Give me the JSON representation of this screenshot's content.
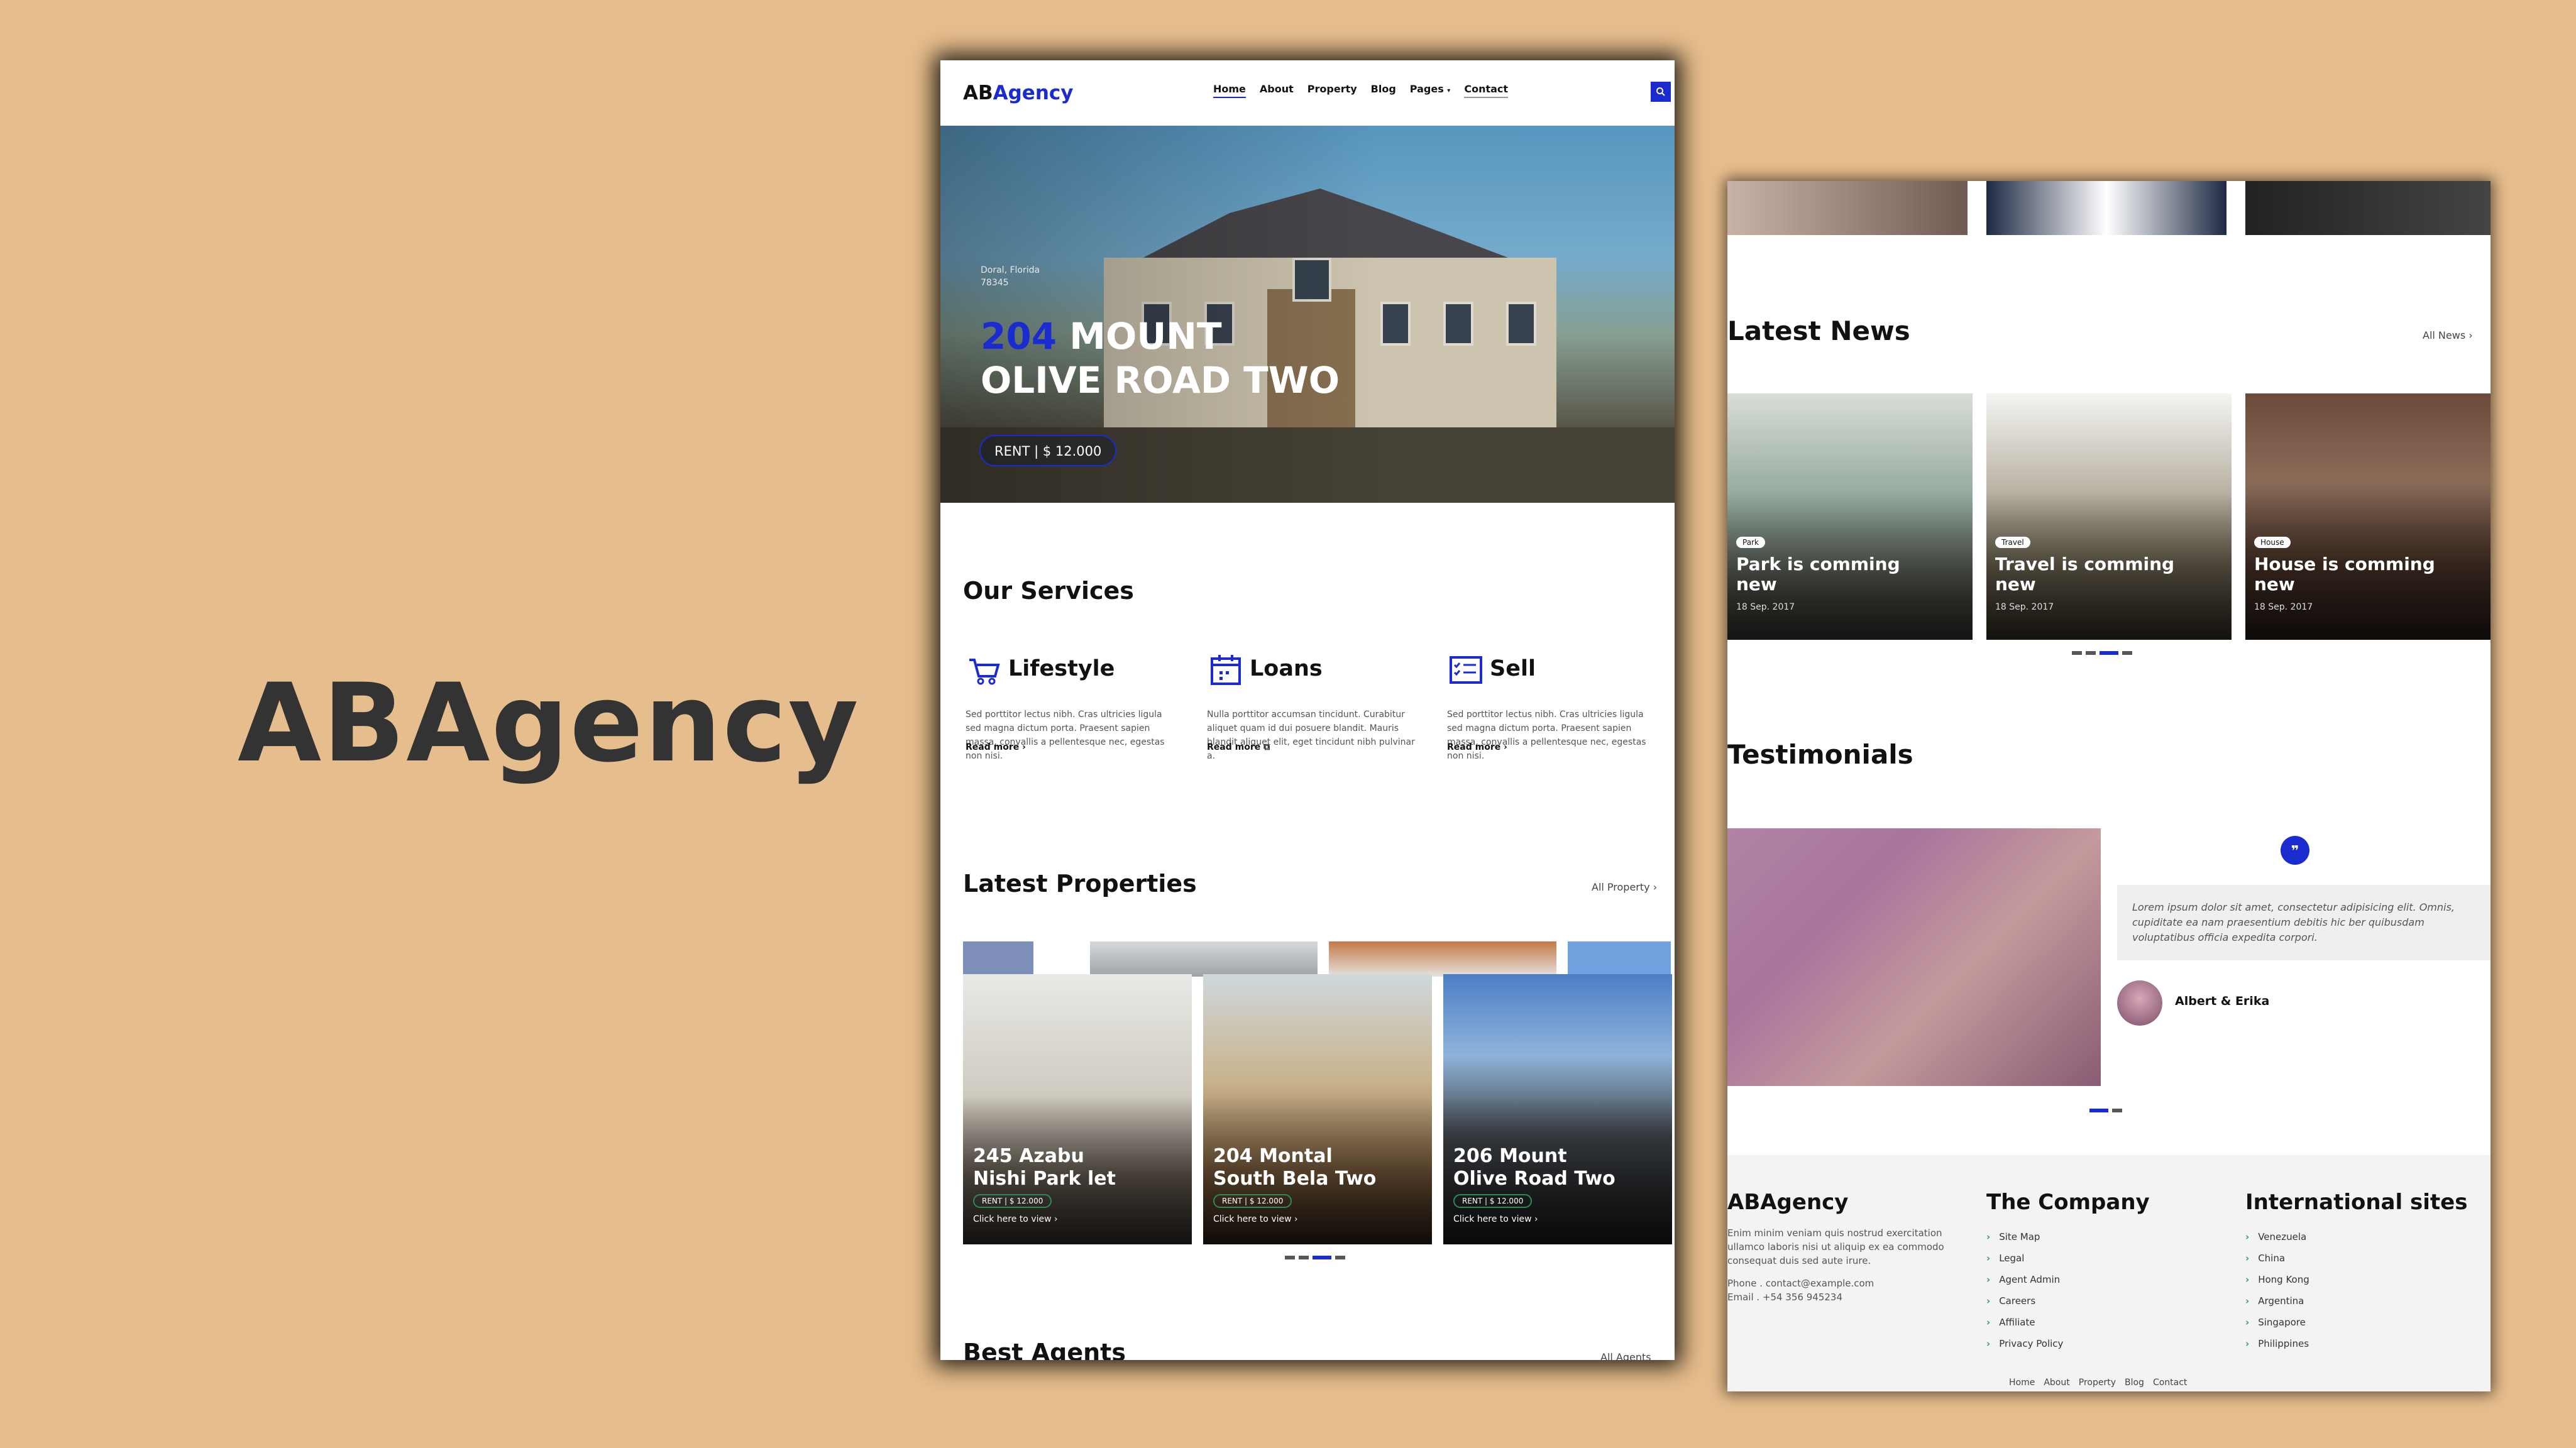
{
  "brand": "ABAgency",
  "site": {
    "logo": {
      "ab": "AB",
      "agency": "Agency"
    },
    "nav": [
      "Home",
      "About",
      "Property",
      "Blog",
      "Pages",
      "Contact"
    ],
    "hero": {
      "city": "Doral, Florida",
      "zip": "78345",
      "title_number": "204",
      "title_rest_line1": "MOUNT",
      "title_line2": "OLIVE ROAD TWO",
      "price": "RENT | $ 12.000"
    },
    "services_heading": "Our Services",
    "services": [
      {
        "icon": "cart-icon",
        "title": "Lifestyle",
        "text": "Sed porttitor lectus nibh. Cras ultricies ligula sed magna dictum porta. Praesent sapien massa, convallis a pellentesque nec, egestas non nisi.",
        "more": "Read more"
      },
      {
        "icon": "calendar-icon",
        "title": "Loans",
        "text": "Nulla porttitor accumsan tincidunt. Curabitur aliquet quam id dui posuere blandit. Mauris blandit aliquet elit, eget tincidunt nibh pulvinar a.",
        "more": "Read more"
      },
      {
        "icon": "checklist-icon",
        "title": "Sell",
        "text": "Sed porttitor lectus nibh. Cras ultricies ligula sed magna dictum porta. Praesent sapien massa, convallis a pellentesque nec, egestas non nisi.",
        "more": "Read more"
      }
    ],
    "properties_heading": "Latest Properties",
    "properties_all": "All Property",
    "properties": [
      {
        "line1": "245 Azabu",
        "line2": "Nishi Park let",
        "price": "RENT | $ 12.000",
        "cta": "Click here to view"
      },
      {
        "line1": "204 Montal",
        "line2": "South Bela Two",
        "price": "RENT | $ 12.000",
        "cta": "Click here to view"
      },
      {
        "line1": "206 Mount",
        "line2": "Olive Road Two",
        "price": "RENT | $ 12.000",
        "cta": "Click here to view"
      }
    ],
    "agents_heading": "Best Agents",
    "agents_all": "All Agents"
  },
  "page2": {
    "news_heading": "Latest News",
    "news_all": "All News",
    "news": [
      {
        "tag": "Park",
        "line1": "Park is comming",
        "line2": "new",
        "date": "18 Sep. 2017"
      },
      {
        "tag": "Travel",
        "line1": "Travel is comming",
        "line2": "new",
        "date": "18 Sep. 2017"
      },
      {
        "tag": "House",
        "line1": "House is comming",
        "line2": "new",
        "date": "18 Sep. 2017"
      }
    ],
    "testimonials_heading": "Testimonials",
    "quote": "Lorem ipsum dolor sit amet, consectetur adipisicing elit. Omnis, cupiditate ea nam praesentium debitis hic ber quibusdam voluptatibus officia expedita corpori.",
    "author": "Albert & Erika",
    "footer": {
      "brand": "ABAgency",
      "about": "Enim minim veniam quis nostrud exercitation ullamco laboris nisi ut aliquip ex ea commodo consequat duis sed aute irure.",
      "phone_label": "Phone .",
      "phone_value": "contact@example.com",
      "email_label": "Email .",
      "email_value": "+54 356 945234",
      "company_heading": "The Company",
      "company_links": [
        "Site Map",
        "Legal",
        "Agent Admin",
        "Careers",
        "Affiliate",
        "Privacy Policy"
      ],
      "intl_heading": "International sites",
      "intl_links": [
        "Venezuela",
        "China",
        "Hong Kong",
        "Argentina",
        "Singapore",
        "Philippines"
      ],
      "bottom_nav": [
        "Home",
        "About",
        "Property",
        "Blog",
        "Contact"
      ]
    }
  },
  "colors": {
    "accent": "#1a2ccf",
    "background": "#e6bd8c",
    "green": "#2aa24b"
  }
}
